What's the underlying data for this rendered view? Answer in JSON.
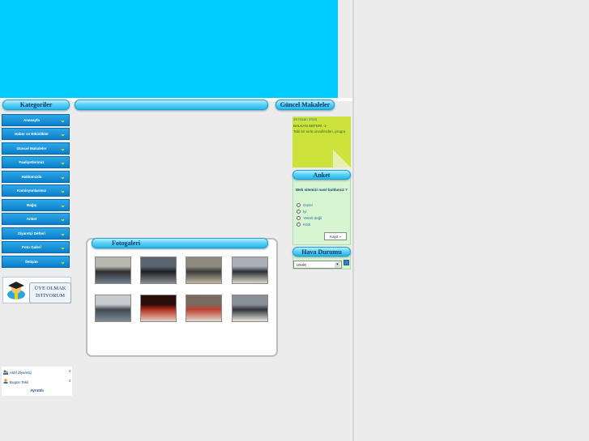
{
  "sidebar": {
    "title": "Kategoriler",
    "items": [
      {
        "label": "Anasayfa"
      },
      {
        "label": "Haber ve Etkinlikler"
      },
      {
        "label": "Güncel Makaleler"
      },
      {
        "label": "Faaliyetlerimiz"
      },
      {
        "label": "Hakkımızda"
      },
      {
        "label": "Komisyonlarımız"
      },
      {
        "label": "Bağış"
      },
      {
        "label": "Anket"
      },
      {
        "label": "Ziyaretçi Defteri"
      },
      {
        "label": "Foto Galeri"
      },
      {
        "label": "İletişim"
      }
    ],
    "member_banner": {
      "line1": "ÜYE OLMAK",
      "line2": "İSTİYORUM"
    }
  },
  "stats": {
    "active_label": "Aktif Ziyaretçi",
    "active_value": "2",
    "today_label": "Bugün Tekil",
    "today_value": "2",
    "detail_link": "Ayrıntılı"
  },
  "gallery": {
    "title": "Fotogaleri",
    "photos": [
      {
        "icon": "meeting-photo"
      },
      {
        "icon": "group-photo"
      },
      {
        "icon": "conference-photo"
      },
      {
        "icon": "hall-photo"
      },
      {
        "icon": "event-photo"
      },
      {
        "icon": "stage-photo"
      },
      {
        "icon": "ceremony-photo"
      },
      {
        "icon": "lecture-photo"
      }
    ]
  },
  "articles": {
    "title": "Güncel Makaleler",
    "date": "26 Nisan 2016",
    "headline": "BALKAN SEFERİ -1-",
    "excerpt": "Tabi bir sırla unvullerden, progra"
  },
  "poll": {
    "title": "Anket",
    "question": "Web sitemizi nasıl buldunuz ?",
    "options": [
      "Güzel",
      "İyi",
      "Yeterli değil",
      "Kötü"
    ],
    "submit": "Kaydet »",
    "submit_short": "Kayıt »"
  },
  "weather": {
    "title": "Hava Durumu",
    "city": "İZMİR"
  },
  "colors": {
    "banner": "#00ccff",
    "menu": "#0a7fcc",
    "chevron": "#e6f000",
    "note": "#cde23a"
  }
}
